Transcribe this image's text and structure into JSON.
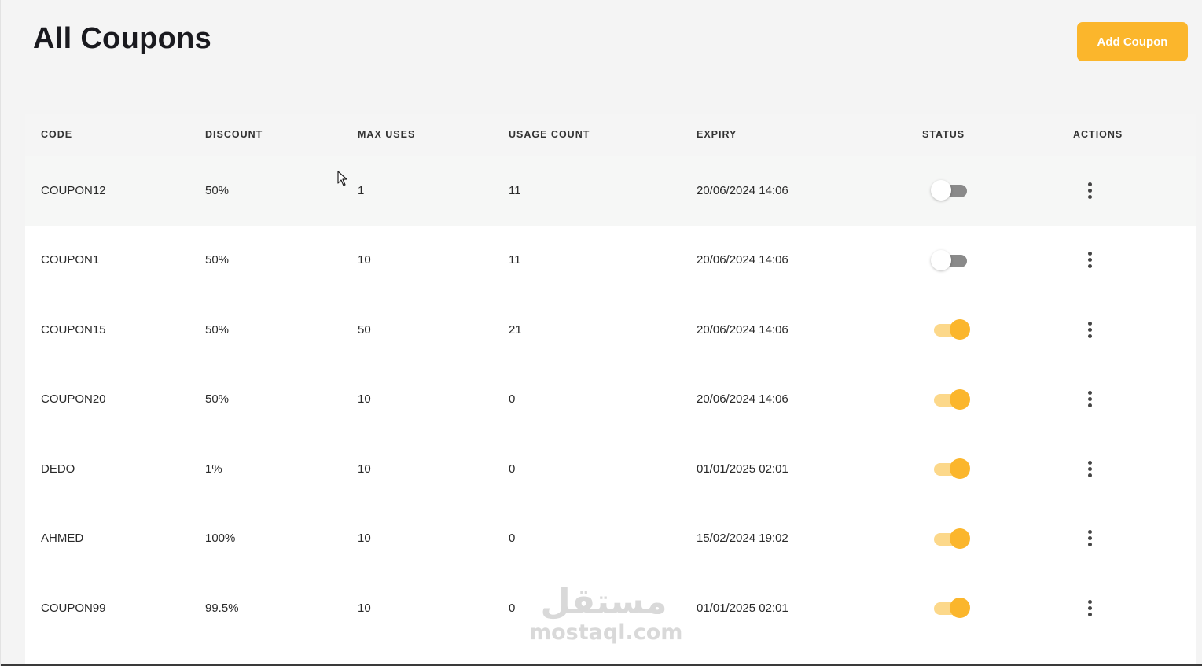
{
  "header": {
    "title": "All Coupons",
    "add_button_label": "Add Coupon"
  },
  "colors": {
    "accent": "#fbb62c",
    "toggle_on_track": "#fcd88a",
    "toggle_off_track": "#8a8a8a",
    "page_bg": "#f4f4f4"
  },
  "table": {
    "columns": [
      "CODE",
      "DISCOUNT",
      "MAX USES",
      "USAGE COUNT",
      "EXPIRY",
      "STATUS",
      "ACTIONS"
    ],
    "rows": [
      {
        "code": "COUPON12",
        "discount": "50%",
        "max_uses": "1",
        "usage_count": "11",
        "expiry": "20/06/2024 14:06",
        "status": false,
        "actions_icon": "more-vertical-icon"
      },
      {
        "code": "COUPON1",
        "discount": "50%",
        "max_uses": "10",
        "usage_count": "11",
        "expiry": "20/06/2024 14:06",
        "status": false,
        "actions_icon": "more-vertical-icon"
      },
      {
        "code": "COUPON15",
        "discount": "50%",
        "max_uses": "50",
        "usage_count": "21",
        "expiry": "20/06/2024 14:06",
        "status": true,
        "actions_icon": "more-vertical-icon"
      },
      {
        "code": "COUPON20",
        "discount": "50%",
        "max_uses": "10",
        "usage_count": "0",
        "expiry": "20/06/2024 14:06",
        "status": true,
        "actions_icon": "more-vertical-icon"
      },
      {
        "code": "DEDO",
        "discount": "1%",
        "max_uses": "10",
        "usage_count": "0",
        "expiry": "01/01/2025 02:01",
        "status": true,
        "actions_icon": "more-vertical-icon"
      },
      {
        "code": "AHMED",
        "discount": "100%",
        "max_uses": "10",
        "usage_count": "0",
        "expiry": "15/02/2024 19:02",
        "status": true,
        "actions_icon": "more-vertical-icon"
      },
      {
        "code": "COUPON99",
        "discount": "99.5%",
        "max_uses": "10",
        "usage_count": "0",
        "expiry": "01/01/2025 02:01",
        "status": true,
        "actions_icon": "more-vertical-icon"
      }
    ]
  },
  "watermark": {
    "arabic": "مستقل",
    "latin": "mostaql.com"
  }
}
